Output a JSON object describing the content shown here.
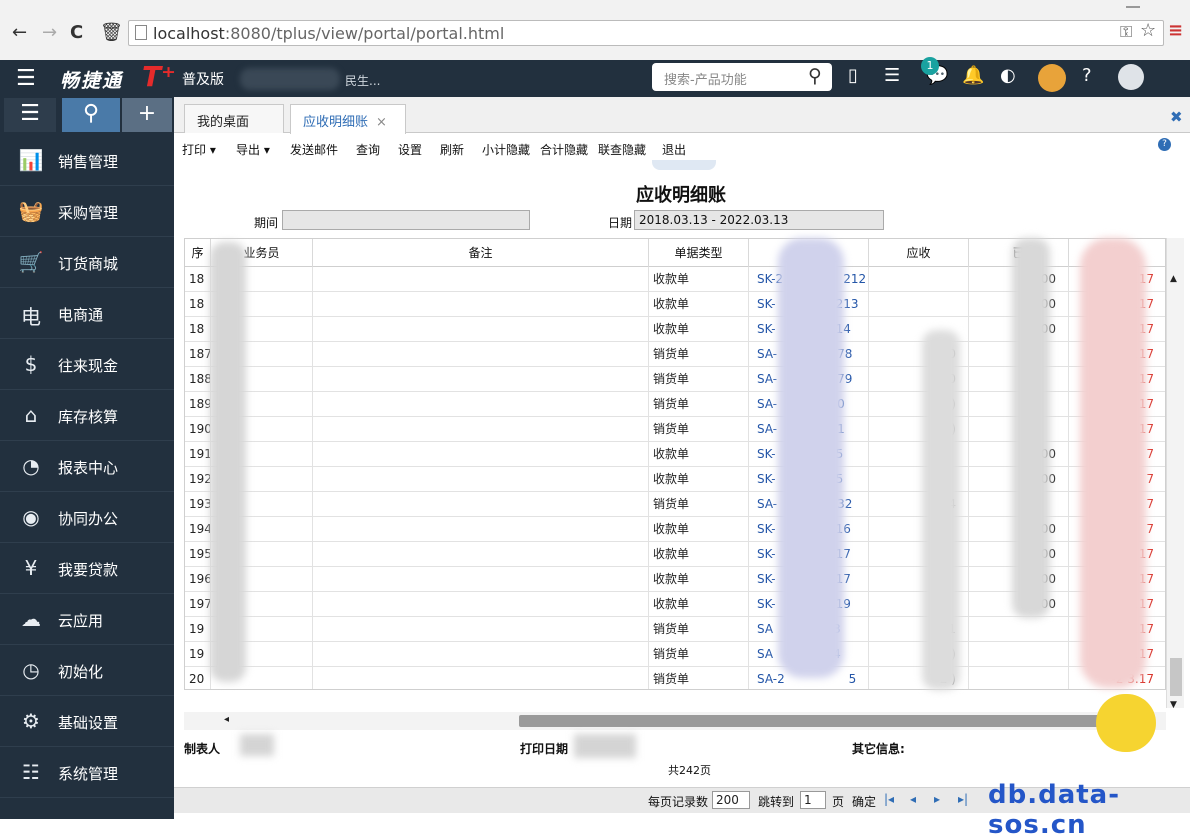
{
  "browser": {
    "url_host": "localhost",
    "url_rest": ":8080/tplus/view/portal/portal.html"
  },
  "app": {
    "brand": "畅捷通",
    "brand_t": "T⁺",
    "edition": "普及版",
    "company_suffix": "民生...",
    "search_placeholder": "搜索-产品功能",
    "notification_count": "1"
  },
  "sidebar": {
    "items": [
      {
        "label": "销售管理",
        "icon": "chart-icon"
      },
      {
        "label": "采购管理",
        "icon": "basket-icon"
      },
      {
        "label": "订货商城",
        "icon": "cart-icon"
      },
      {
        "label": "电商通",
        "icon": "ecommerce-icon"
      },
      {
        "label": "往来现金",
        "icon": "dollar-icon"
      },
      {
        "label": "库存核算",
        "icon": "warehouse-icon"
      },
      {
        "label": "报表中心",
        "icon": "pie-icon"
      },
      {
        "label": "协同办公",
        "icon": "target-icon"
      },
      {
        "label": "我要贷款",
        "icon": "loan-icon"
      },
      {
        "label": "云应用",
        "icon": "cloud-icon"
      },
      {
        "label": "初始化",
        "icon": "timer-icon"
      },
      {
        "label": "基础设置",
        "icon": "settings-chart-icon"
      },
      {
        "label": "系统管理",
        "icon": "document-icon"
      }
    ]
  },
  "tabs": [
    {
      "label": "我的桌面"
    },
    {
      "label": "应收明细账"
    }
  ],
  "toolbar": [
    "打印 ▾",
    "导出 ▾",
    "发送邮件",
    "查询",
    "设置",
    "刷新",
    "小计隐藏",
    "合计隐藏",
    "联查隐藏",
    "退出"
  ],
  "report": {
    "title": "应收明细账",
    "period_label": "期间",
    "period_value": "",
    "date_label": "日期",
    "date_value": "2018.03.13 - 2022.03.13"
  },
  "grid": {
    "headers": [
      "序",
      "业务员",
      "备注",
      "单据类型",
      "",
      "应收",
      "已",
      "额"
    ],
    "rows": [
      {
        "no": "18",
        "type": "收款单",
        "doc": "SK-2",
        "doc_tail": "212",
        "recv": "",
        "paid": "00",
        "bal": "888.17"
      },
      {
        "no": "18",
        "type": "收款单",
        "doc": "SK-",
        "doc_tail": "213",
        "recv": "",
        "paid": "00",
        "bal": "263.17"
      },
      {
        "no": "18",
        "type": "收款单",
        "doc": "SK-",
        "doc_tail": "14",
        "recv": "",
        "paid": "00",
        "bal": "23.17"
      },
      {
        "no": "187",
        "type": "销货单",
        "doc": "SA-",
        "doc_tail": "78",
        "recv": "0",
        "paid": "",
        "bal": "3.17"
      },
      {
        "no": "188",
        "type": "销货单",
        "doc": "SA-",
        "doc_tail": "79",
        "recv": "0",
        "paid": "",
        "bal": ".17"
      },
      {
        "no": "189",
        "type": "销货单",
        "doc": "SA-",
        "doc_tail": "0",
        "recv": "4   )",
        "paid": "",
        "bal": "17"
      },
      {
        "no": "190",
        "type": "销货单",
        "doc": "SA-",
        "doc_tail": "1",
        "recv": ")",
        "paid": "",
        "bal": "17"
      },
      {
        "no": "191",
        "type": "收款单",
        "doc": "SK-",
        "doc_tail": "5",
        "recv": "",
        "paid": "00",
        "bal": "7"
      },
      {
        "no": "192",
        "type": "收款单",
        "doc": "SK-",
        "doc_tail": "5",
        "recv": "",
        "paid": "00",
        "bal": "7"
      },
      {
        "no": "193",
        "type": "销货单",
        "doc": "SA-",
        "doc_tail": "32",
        "recv": "324",
        "paid": "",
        "bal": "7"
      },
      {
        "no": "194",
        "type": "收款单",
        "doc": "SK-",
        "doc_tail": "16",
        "recv": "",
        "paid": "00",
        "bal": "7"
      },
      {
        "no": "195",
        "type": "收款单",
        "doc": "SK-",
        "doc_tail": "17",
        "recv": "",
        "paid": "00",
        "bal": "17"
      },
      {
        "no": "196",
        "type": "收款单",
        "doc": "SK-",
        "doc_tail": "17",
        "recv": "",
        "paid": "-    00",
        "bal": "17"
      },
      {
        "no": "197",
        "type": "收款单",
        "doc": "SK-",
        "doc_tail": "19",
        "recv": "",
        "paid": "00",
        "bal": ".17"
      },
      {
        "no": "19",
        "type": "销货单",
        "doc": "SA",
        "doc_tail": "3",
        "recv": "1",
        "paid": "",
        "bal": "-2   .17"
      },
      {
        "no": "19",
        "type": "销货单",
        "doc": "SA",
        "doc_tail": "4",
        "recv": "5   )",
        "paid": "",
        "bal": "-2   .17"
      },
      {
        "no": "20",
        "type": "销货单",
        "doc": "SA-2 ",
        "doc_tail": "5",
        "recv": "2   )",
        "paid": "",
        "bal": "-2   3.17"
      }
    ]
  },
  "footer": {
    "maker_label": "制表人",
    "print_date_label": "打印日期",
    "other_label": "其它信息:",
    "page_total": "共242页"
  },
  "pager": {
    "per_page_label": "每页记录数",
    "per_page_value": "200",
    "jump_label": "跳转到",
    "jump_value": "1",
    "page_unit": "页",
    "confirm": "确定"
  },
  "watermark": "db.data-sos.cn"
}
